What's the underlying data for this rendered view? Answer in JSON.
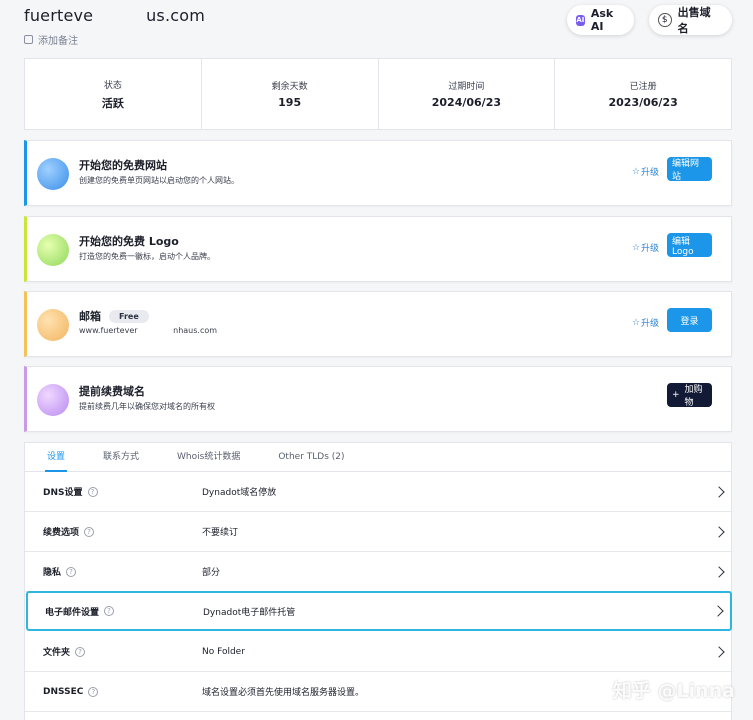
{
  "header": {
    "domain": "fuerteve          us.com",
    "note_label": "添加备注",
    "ask_ai_label": "Ask AI",
    "sell_label": "出售域名"
  },
  "stats": [
    {
      "label": "状态",
      "value": "活跃"
    },
    {
      "label": "剩余天数",
      "value": "195"
    },
    {
      "label": "过期时间",
      "value": "2024/06/23"
    },
    {
      "label": "已注册",
      "value": "2023/06/23"
    }
  ],
  "cards": [
    {
      "title": "开始您的免费网站",
      "desc": "创建您的免费单页网站以启动您的个人网站。",
      "upgrade": "升级",
      "button": "编辑网站",
      "accent": "#1b96e8"
    },
    {
      "title": "开始您的免费 Logo",
      "desc": "打造您的免费一徽标，启动个人品牌。",
      "upgrade": "升级",
      "button": "编辑Logo",
      "accent": "#c8e63a"
    },
    {
      "title": "邮箱",
      "badge": "Free",
      "desc": "www.fuertever              nhaus.com",
      "upgrade": "升级",
      "button": "登录",
      "accent": "#f5c25a"
    },
    {
      "title": "提前续费域名",
      "desc": "提前续费几年以确保您对域名的所有权",
      "button": "加购物",
      "button_prefix": "+",
      "accent": "#c99ae6"
    }
  ],
  "tabs": [
    "设置",
    "联系方式",
    "Whois统计数据",
    "Other TLDs (2)"
  ],
  "rows": [
    {
      "label": "DNS设置",
      "value": "Dynadot域名停放",
      "help": true
    },
    {
      "label": "续费选项",
      "value": "不要续订",
      "help": true
    },
    {
      "label": "隐私",
      "value": "部分",
      "help": true
    },
    {
      "label": "电子邮件设置",
      "value": "Dynadot电子邮件托管",
      "help": true
    },
    {
      "label": "文件夹",
      "value": "No Folder",
      "help": true
    },
    {
      "label": "DNSSEC",
      "value": "域名设置必须首先使用域名服务器设置。",
      "help": true
    }
  ],
  "watermark": "知乎 @Linna"
}
